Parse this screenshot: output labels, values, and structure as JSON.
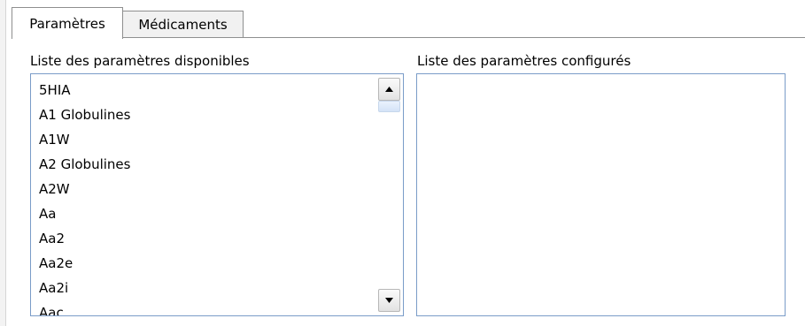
{
  "tabs": [
    {
      "label": "Paramètres",
      "active": true
    },
    {
      "label": "Médicaments",
      "active": false
    }
  ],
  "available_list": {
    "label": "Liste des paramètres disponibles",
    "items": [
      "5HIA",
      "A1 Globulines",
      "A1W",
      "A2 Globulines",
      "A2W",
      "Aa",
      "Aa2",
      "Aa2e",
      "Aa2i",
      "Aac"
    ]
  },
  "configured_list": {
    "label": "Liste des paramètres configurés",
    "items": []
  },
  "colors": {
    "list_border": "#7a9cc8",
    "tab_border": "#8e8f8f",
    "scroll_thumb": "#d4e3f7"
  },
  "icons": {
    "scroll_up": "triangle-up-icon",
    "scroll_down": "triangle-down-icon"
  }
}
